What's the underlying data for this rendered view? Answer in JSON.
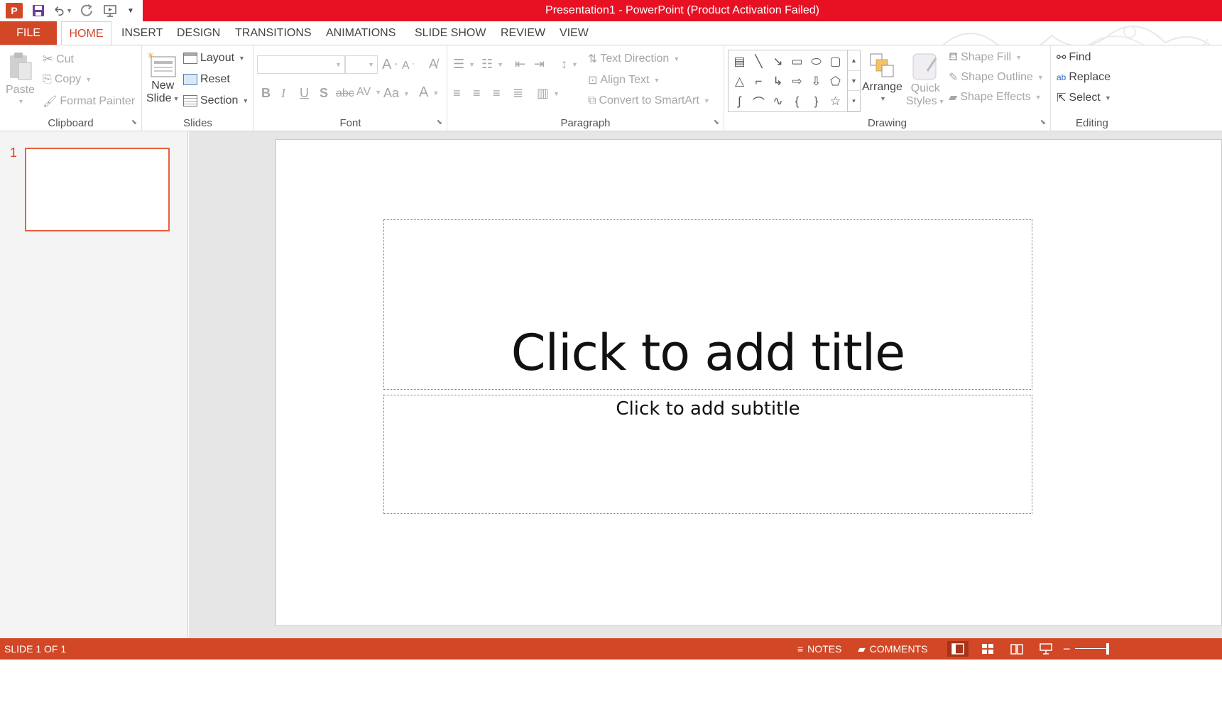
{
  "window": {
    "title": "Presentation1 -  PowerPoint (Product Activation Failed)",
    "title_color": "#e81123",
    "accent": "#d24726"
  },
  "qat": {
    "icons": [
      "powerpoint-logo-icon",
      "save-icon",
      "undo-icon",
      "redo-icon",
      "slideshow-from-start-icon",
      "customize-qat-icon"
    ],
    "logo_letter": "P"
  },
  "tabs": [
    {
      "label": "FILE"
    },
    {
      "label": "HOME"
    },
    {
      "label": "INSERT"
    },
    {
      "label": "DESIGN"
    },
    {
      "label": "TRANSITIONS"
    },
    {
      "label": "ANIMATIONS"
    },
    {
      "label": "SLIDE SHOW"
    },
    {
      "label": "REVIEW"
    },
    {
      "label": "VIEW"
    }
  ],
  "ribbon": {
    "clipboard": {
      "label": "Clipboard",
      "paste": "Paste",
      "cut": "Cut",
      "copy": "Copy",
      "format_painter": "Format Painter"
    },
    "slides": {
      "label": "Slides",
      "new_slide_line1": "New",
      "new_slide_line2": "Slide",
      "layout": "Layout",
      "reset": "Reset",
      "section": "Section"
    },
    "font": {
      "label": "Font",
      "font_name_value": "",
      "font_size_value": ""
    },
    "paragraph": {
      "label": "Paragraph",
      "text_direction": "Text Direction",
      "align_text": "Align Text",
      "convert_smartart": "Convert to SmartArt"
    },
    "drawing": {
      "label": "Drawing",
      "arrange": "Arrange",
      "quick_styles_line1": "Quick",
      "quick_styles_line2": "Styles",
      "shape_fill": "Shape Fill",
      "shape_outline": "Shape Outline",
      "shape_effects": "Shape Effects"
    },
    "editing": {
      "label": "Editing",
      "find": "Find",
      "replace": "Replace",
      "select": "Select"
    }
  },
  "thumbnails": [
    {
      "number": "1"
    }
  ],
  "slide": {
    "title_placeholder": "Click to add title",
    "subtitle_placeholder": "Click to add subtitle"
  },
  "statusbar": {
    "slide_info": "SLIDE 1 OF 1",
    "notes": "NOTES",
    "comments": "COMMENTS"
  }
}
